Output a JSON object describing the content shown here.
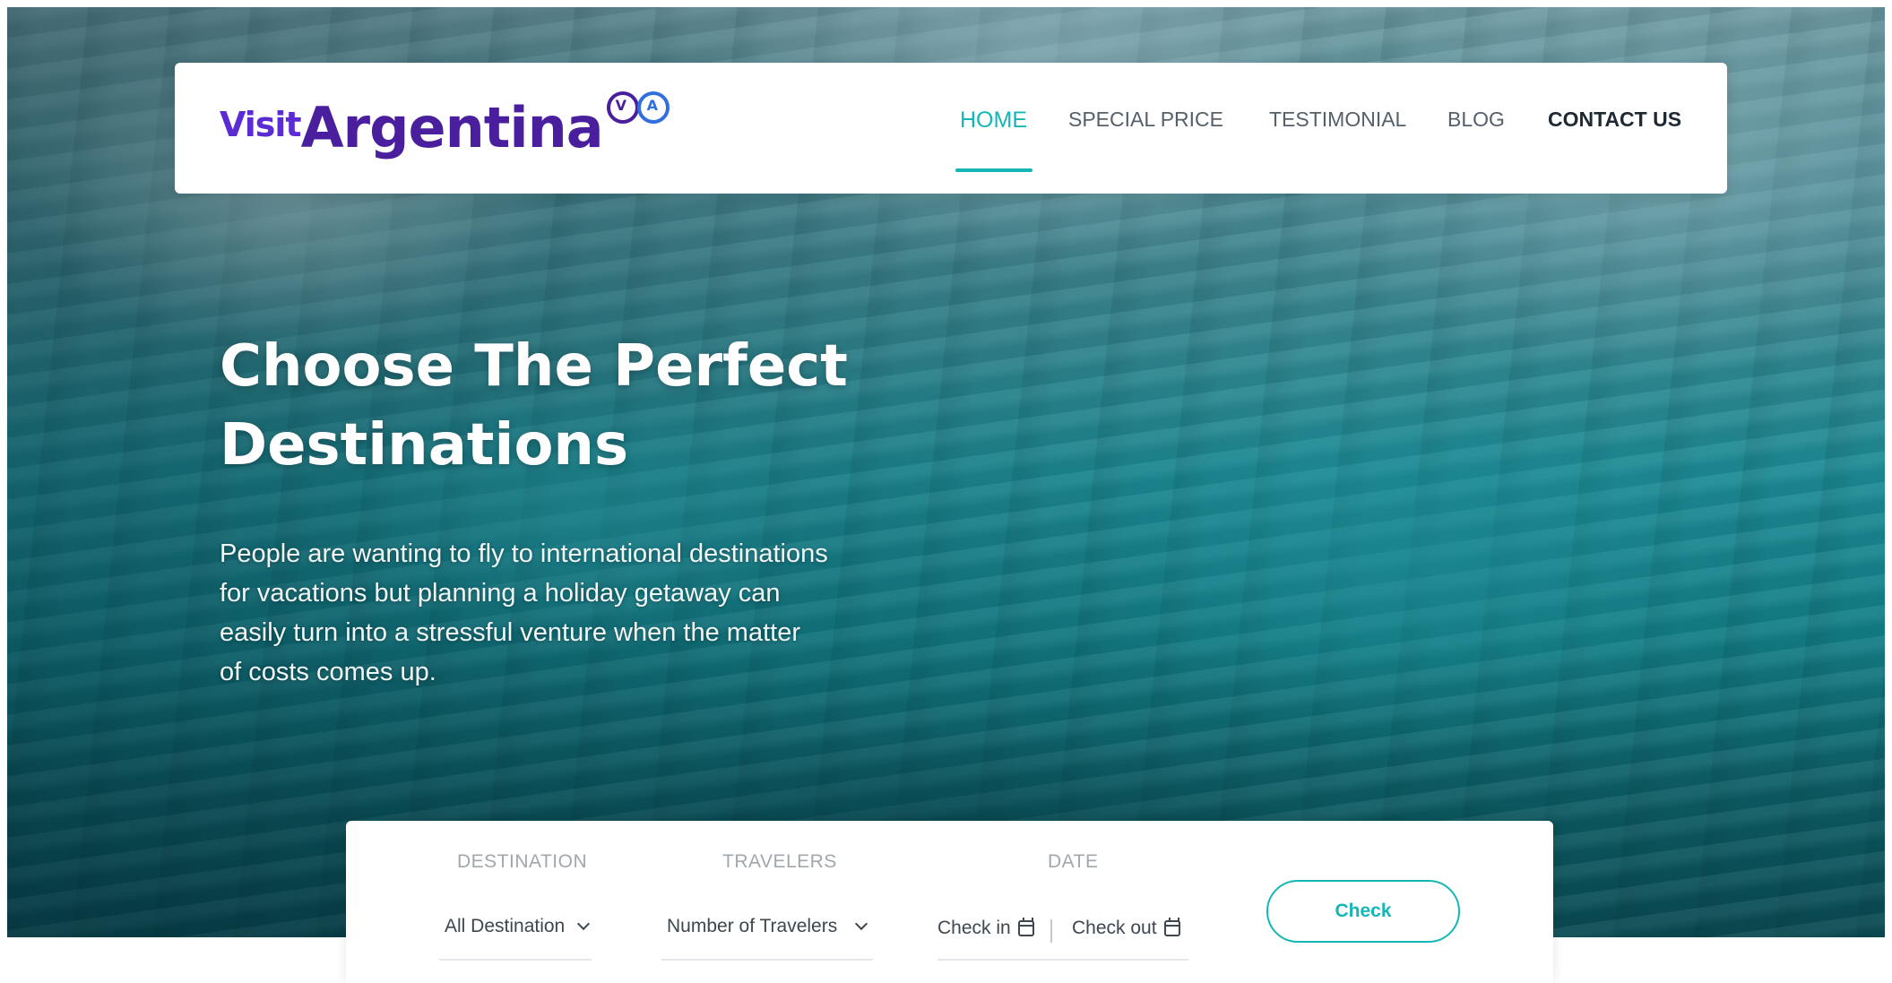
{
  "brand": {
    "logo_prefix": "Visit",
    "logo_name": "Argentina",
    "logo_mark_left": "V",
    "logo_mark_right": "A",
    "colors": {
      "primary": "#4a1f9e",
      "accent": "#14b7b6",
      "logo_light": "#5b2bd6",
      "logo_blue": "#2f6fe0"
    }
  },
  "nav": {
    "items": [
      {
        "label": "HOME",
        "active": true
      },
      {
        "label": "SPECIAL PRICE",
        "active": false
      },
      {
        "label": "TESTIMONIAL",
        "active": false
      },
      {
        "label": "BLOG",
        "active": false
      },
      {
        "label": "CONTACT US",
        "active": false
      }
    ]
  },
  "hero": {
    "title_line1": "Choose The Perfect",
    "title_line2": "Destinations",
    "description": "People are wanting to fly to international destinations for vacations but planning a holiday getaway can easily turn into a stressful venture when the matter of costs comes up.",
    "background": "glacier-ice-photo"
  },
  "booking": {
    "destination": {
      "label": "DESTINATION",
      "value": "All Destination"
    },
    "travelers": {
      "label": "TRAVELERS",
      "value": "Number of Travelers"
    },
    "date": {
      "label": "DATE",
      "check_in": "Check in",
      "check_out": "Check out"
    },
    "submit_label": "Check",
    "icons": [
      "chevron-down-icon",
      "calendar-icon"
    ]
  }
}
